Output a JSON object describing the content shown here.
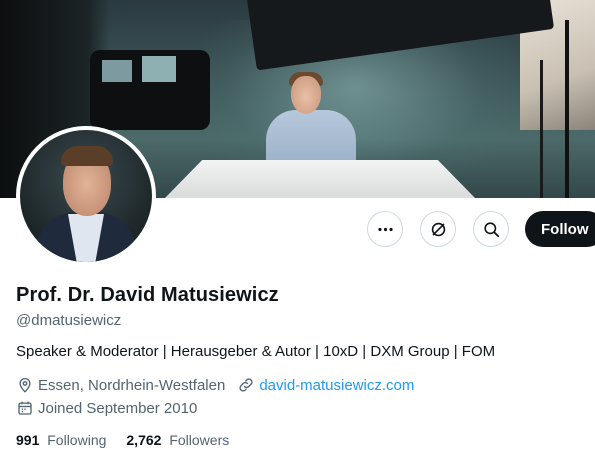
{
  "profile": {
    "name": "Prof. Dr. David Matusiewicz",
    "handle": "@dmatusiewicz",
    "bio": "Speaker & Moderator | Herausgeber & Autor | 10xD | DXM Group | FOM",
    "location": "Essen, Nordrhein-Westfalen",
    "website": "david-matusiewicz.com",
    "joined": "Joined September 2010"
  },
  "stats": {
    "following_count": "991",
    "following_label": "Following",
    "followers_count": "2,762",
    "followers_label": "Followers"
  },
  "actions": {
    "more": "more-icon",
    "grok": "grok-icon",
    "search": "search-icon",
    "follow_label": "Follow"
  },
  "colors": {
    "accent": "#1d9bf0",
    "primary_text": "#0f1419",
    "secondary_text": "#536471",
    "follow_bg": "#0f1419"
  }
}
